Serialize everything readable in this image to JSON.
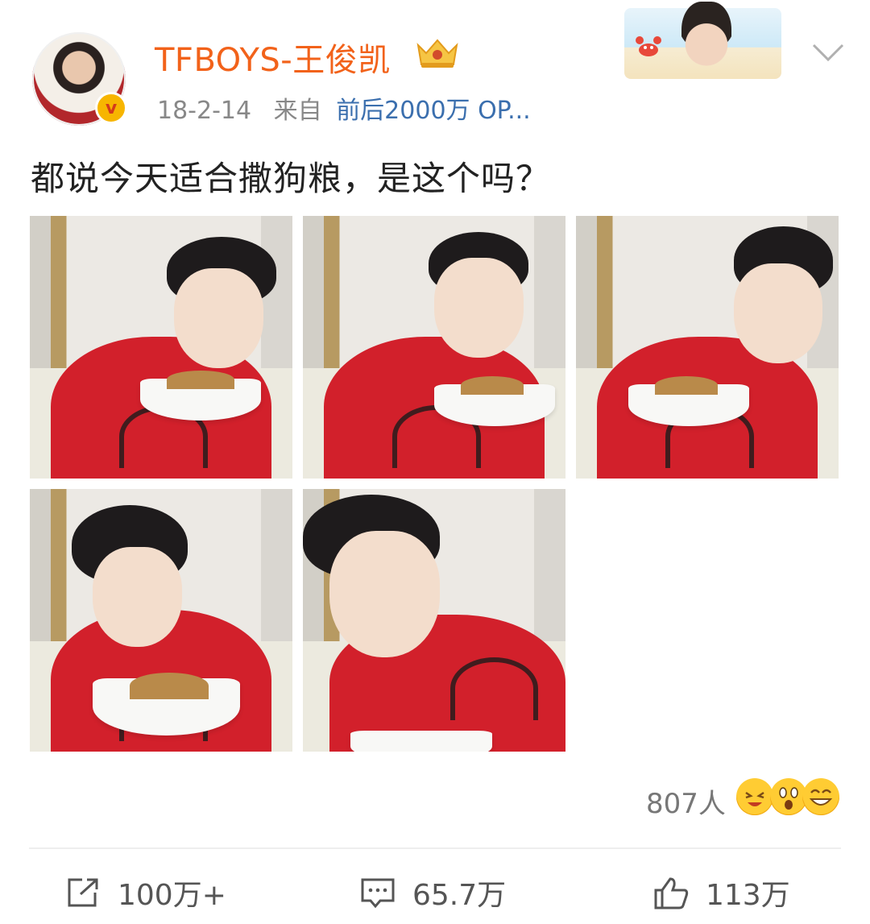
{
  "user": {
    "name": "TFBOYS-王俊凯",
    "verified_badge": "v",
    "date": "18-2-14",
    "from_label": "来自",
    "source": "前后2000万 OP..."
  },
  "post": {
    "text": "都说今天适合撒狗粮，是这个吗？",
    "photo_count": 5
  },
  "reactions": {
    "count": "807人"
  },
  "actions": {
    "repost": "100万+",
    "comment": "65.7万",
    "like": "113万"
  },
  "colors": {
    "username": "#f2621a",
    "source_link": "#3b6fae",
    "shirt_red": "#d2202b"
  }
}
